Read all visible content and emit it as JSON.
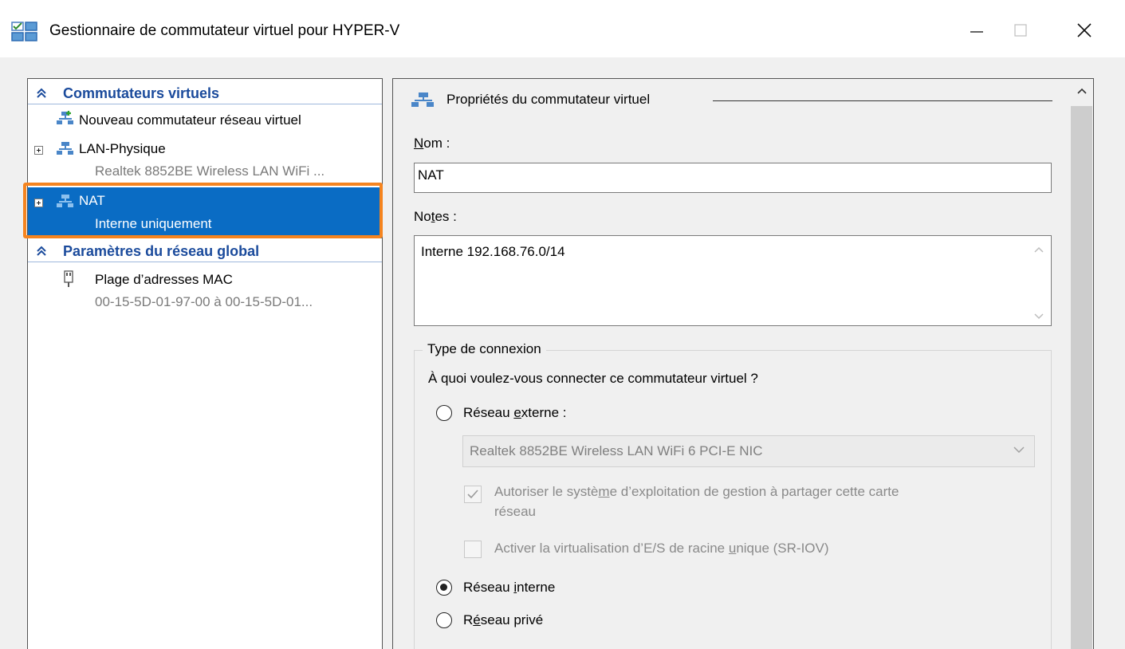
{
  "window": {
    "title": "Gestionnaire de commutateur virtuel pour HYPER-V",
    "minimize_glyph": "—",
    "maximize_glyph": "☐",
    "close_glyph": "✕"
  },
  "sidebar": {
    "section_switches": "Commutateurs virtuels",
    "new_switch": "Nouveau commutateur réseau virtuel",
    "items": [
      {
        "name": "LAN-Physique",
        "detail": "Realtek 8852BE Wireless LAN WiFi ..."
      },
      {
        "name": "NAT",
        "detail": "Interne uniquement"
      }
    ],
    "section_global": "Paramètres du réseau global",
    "mac_range_label": "Plage d’adresses MAC",
    "mac_range_detail": "00-15-5D-01-97-00 à 00-15-5D-01..."
  },
  "properties": {
    "group_title": "Propriétés du commutateur virtuel",
    "name_label_prefix": "N",
    "name_label_rest": "om :",
    "name_value": "NAT",
    "notes_label_prefix": "No",
    "notes_label_u": "t",
    "notes_label_rest": "es :",
    "notes_value": "Interne 192.168.76.0/14",
    "connection": {
      "legend": "Type de connexion",
      "question": "À quoi voulez-vous connecter ce commutateur virtuel ?",
      "external_a": "Réseau ",
      "external_u": "e",
      "external_b": "xterne :",
      "adapter": "Realtek 8852BE Wireless LAN WiFi 6 PCI-E NIC",
      "share_line1_a": "Autoriser le systè",
      "share_line1_u": "m",
      "share_line1_b": "e d’exploitation de gestion à partager cette carte",
      "share_line2": "réseau",
      "sriov_a": "Activer la virtualisation d’E/S de racine ",
      "sriov_u": "u",
      "sriov_b": "nique (SR-IOV)",
      "internal_a": "Réseau ",
      "internal_u": "i",
      "internal_b": "nterne",
      "private_a": "R",
      "private_u": "é",
      "private_b": "seau privé",
      "selected": "internal"
    }
  },
  "colors": {
    "selection": "#0a6cc4",
    "highlight": "#f5841f",
    "section_heading": "#1b4b9c"
  }
}
